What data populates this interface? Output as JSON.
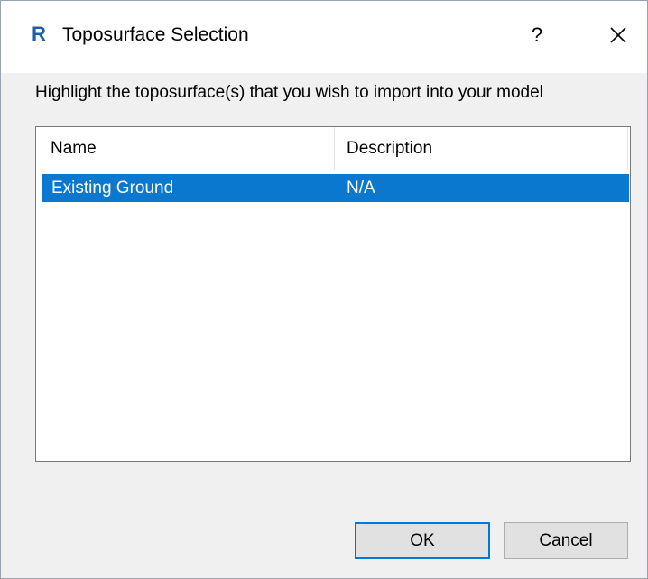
{
  "window": {
    "app_icon_letter": "R",
    "title": "Toposurface Selection",
    "help_label": "?",
    "close_icon": "close-icon"
  },
  "instruction": "Highlight the toposurface(s) that you wish to import into your model",
  "list": {
    "columns": [
      "Name",
      "Description"
    ],
    "rows": [
      {
        "name": "Existing Ground",
        "description": "N/A",
        "selected": true
      }
    ]
  },
  "buttons": {
    "ok_label": "OK",
    "cancel_label": "Cancel"
  },
  "colors": {
    "selection": "#0b78d0",
    "app_icon": "#1d5fa8",
    "focus_border": "#0078d7"
  }
}
